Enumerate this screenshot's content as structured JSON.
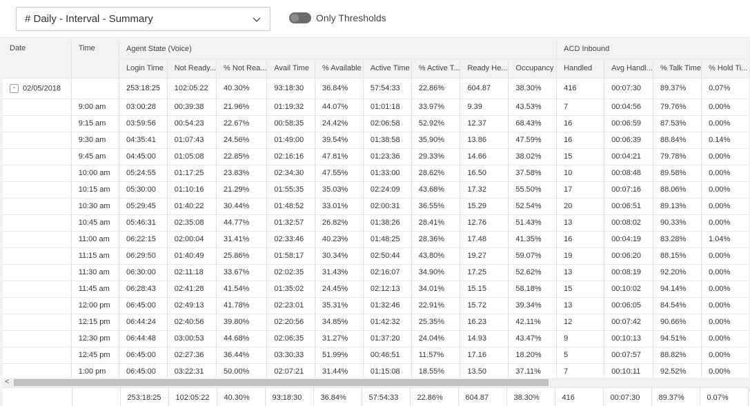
{
  "report_select": {
    "value": "# Daily - Interval - Summary"
  },
  "thresholds_toggle": {
    "label": "Only Thresholds",
    "on": false
  },
  "group_headers": {
    "date": "Date",
    "time": "Time",
    "agent_state": "Agent State (Voice)",
    "acd_inbound": "ACD Inbound"
  },
  "columns": [
    "Login Time",
    "Not Ready...",
    "% Not Rea...",
    "Avail Time",
    "% Available",
    "Active Time",
    "% Active T...",
    "Ready He...",
    "Occupancy",
    "Handled",
    "Avg Handl...",
    "% Talk Time",
    "% Hold Ti..."
  ],
  "date_group": {
    "toggle": "-",
    "date": "02/05/2018",
    "values": [
      "253:18:25",
      "102:05:22",
      "40.30%",
      "93:18:30",
      "36.84%",
      "57:54:33",
      "22.86%",
      "604.87",
      "38.30%",
      "416",
      "00:07:30",
      "89.37%",
      "0.07%"
    ]
  },
  "rows": [
    {
      "time": "9:00 am",
      "values": [
        "03:00:28",
        "00:39:38",
        "21.96%",
        "01:19:32",
        "44.07%",
        "01:01:18",
        "33.97%",
        "9.39",
        "43.53%",
        "7",
        "00:04:56",
        "79.76%",
        "0.00%"
      ]
    },
    {
      "time": "9:15 am",
      "values": [
        "03:59:56",
        "00:54:23",
        "22.67%",
        "00:58:35",
        "24.42%",
        "02:06:58",
        "52.92%",
        "12.37",
        "68.43%",
        "16",
        "00:06:59",
        "87.53%",
        "0.00%"
      ]
    },
    {
      "time": "9:30 am",
      "values": [
        "04:35:41",
        "01:07:43",
        "24.56%",
        "01:49:00",
        "39.54%",
        "01:38:58",
        "35.90%",
        "13.86",
        "47.59%",
        "16",
        "00:06:39",
        "88.84%",
        "0.14%"
      ]
    },
    {
      "time": "9:45 am",
      "values": [
        "04:45:00",
        "01:05:08",
        "22.85%",
        "02:16:16",
        "47.81%",
        "01:23:36",
        "29.33%",
        "14.66",
        "38.02%",
        "15",
        "00:04:21",
        "79.78%",
        "0.00%"
      ]
    },
    {
      "time": "10:00 am",
      "values": [
        "05:24:55",
        "01:17:25",
        "23.83%",
        "02:34:30",
        "47.55%",
        "01:33:00",
        "28.62%",
        "16.50",
        "37.58%",
        "10",
        "00:08:48",
        "89.58%",
        "0.00%"
      ]
    },
    {
      "time": "10:15 am",
      "values": [
        "05:30:00",
        "01:10:16",
        "21.29%",
        "01:55:35",
        "35.03%",
        "02:24:09",
        "43.68%",
        "17.32",
        "55.50%",
        "17",
        "00:07:16",
        "88.06%",
        "0.00%"
      ]
    },
    {
      "time": "10:30 am",
      "values": [
        "05:29:45",
        "01:40:22",
        "30.44%",
        "01:48:52",
        "33.01%",
        "02:00:31",
        "36.55%",
        "15.29",
        "52.54%",
        "20",
        "00:06:51",
        "89.13%",
        "0.00%"
      ]
    },
    {
      "time": "10:45 am",
      "values": [
        "05:46:31",
        "02:35:08",
        "44.77%",
        "01:32:57",
        "26.82%",
        "01:38:26",
        "28.41%",
        "12.76",
        "51.43%",
        "13",
        "00:08:02",
        "90.33%",
        "0.00%"
      ]
    },
    {
      "time": "11:00 am",
      "values": [
        "06:22:15",
        "02:00:04",
        "31.41%",
        "02:33:46",
        "40.23%",
        "01:48:25",
        "28.36%",
        "17.48",
        "41.35%",
        "16",
        "00:04:19",
        "83.28%",
        "1.04%"
      ]
    },
    {
      "time": "11:15 am",
      "values": [
        "06:29:50",
        "01:40:49",
        "25.86%",
        "01:58:17",
        "30.34%",
        "02:50:44",
        "43.80%",
        "19.27",
        "59.07%",
        "19",
        "00:06:20",
        "88.15%",
        "0.00%"
      ]
    },
    {
      "time": "11:30 am",
      "values": [
        "06:30:00",
        "02:11:18",
        "33.67%",
        "02:02:35",
        "31.43%",
        "02:16:07",
        "34.90%",
        "17.25",
        "52.62%",
        "13",
        "00:08:19",
        "92.20%",
        "0.00%"
      ]
    },
    {
      "time": "11:45 am",
      "values": [
        "06:28:43",
        "02:41:28",
        "41.54%",
        "01:35:02",
        "24.45%",
        "02:12:13",
        "34.01%",
        "15.15",
        "58.18%",
        "15",
        "00:10:02",
        "94.14%",
        "0.00%"
      ]
    },
    {
      "time": "12:00 pm",
      "values": [
        "06:45:00",
        "02:49:13",
        "41.78%",
        "02:23:01",
        "35.31%",
        "01:32:46",
        "22.91%",
        "15.72",
        "39.34%",
        "13",
        "00:06:05",
        "84.54%",
        "0.00%"
      ]
    },
    {
      "time": "12:15 pm",
      "values": [
        "06:44:24",
        "02:40:56",
        "39.80%",
        "02:20:56",
        "34.85%",
        "01:42:32",
        "25.35%",
        "16.23",
        "42.11%",
        "12",
        "00:07:42",
        "90.66%",
        "0.00%"
      ]
    },
    {
      "time": "12:30 pm",
      "values": [
        "06:44:48",
        "03:00:53",
        "44.68%",
        "02:06:35",
        "31.27%",
        "01:37:20",
        "24.04%",
        "14.93",
        "43.47%",
        "9",
        "00:10:13",
        "94.51%",
        "0.00%"
      ]
    },
    {
      "time": "12:45 pm",
      "values": [
        "06:45:00",
        "02:27:36",
        "36.44%",
        "03:30:33",
        "51.99%",
        "00:46:51",
        "11.57%",
        "17.16",
        "18.20%",
        "5",
        "00:07:57",
        "88.82%",
        "0.00%"
      ]
    },
    {
      "time": "1:00 pm",
      "values": [
        "06:45:00",
        "03:22:31",
        "50.00%",
        "02:07:21",
        "31.44%",
        "01:15:08",
        "18.55%",
        "13.50",
        "37.11%",
        "7",
        "00:10:11",
        "92.52%",
        "0.00%"
      ]
    }
  ],
  "totals": [
    "253:18:25",
    "102:05:22",
    "40.30%",
    "93:18:30",
    "36.84%",
    "57:54:33",
    "22.86%",
    "604.87",
    "38.30%",
    "416",
    "00:07:30",
    "89.37%",
    "0.07%"
  ],
  "scrollbar": {
    "left_arrow": "<"
  },
  "icons": {
    "select_chevron": "chevron-down-icon",
    "scroll_left": "chevron-left-icon"
  }
}
